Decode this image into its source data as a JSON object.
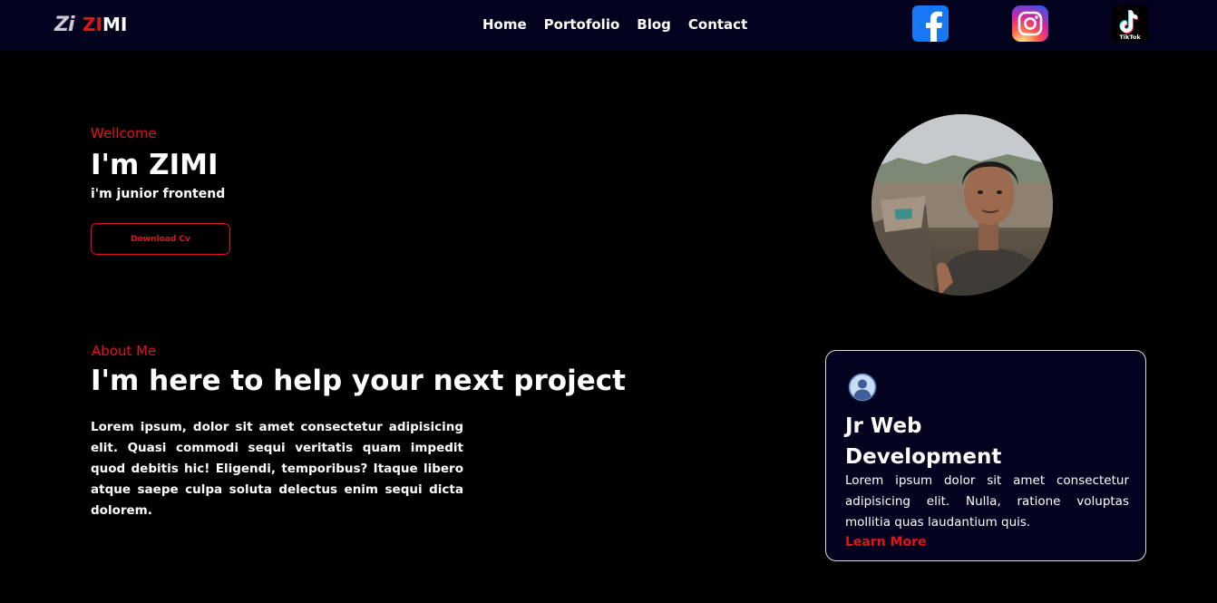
{
  "nav": {
    "logo_mark": "Zi",
    "logo_red": "ZI",
    "logo_white": "MI",
    "menu": [
      {
        "label": "Home"
      },
      {
        "label": "Portofolio"
      },
      {
        "label": "Blog"
      },
      {
        "label": "Contact"
      }
    ],
    "social": {
      "facebook_icon": "facebook-icon",
      "instagram_icon": "instagram-icon",
      "tiktok_icon": "tiktok-icon",
      "tiktok_label": "TikTok"
    }
  },
  "hero": {
    "greeting": "Wellcome",
    "title": "I'm ZIMI",
    "role": "i'm junior frontend",
    "cv_button": "Download Cv",
    "photo_icon": "profile-photo"
  },
  "about": {
    "label": "About Me",
    "title": "I'm here to help your next project",
    "text": "Lorem ipsum, dolor sit amet consectetur adipisicing elit. Quasi commodi sequi veritatis quam impedit quod debitis hic! Eligendi, temporibus? Itaque libero atque saepe culpa soluta delectus enim sequi dicta dolorem."
  },
  "service_card": {
    "icon": "user-circle-icon",
    "title": "Jr Web Development",
    "text": "Lorem ipsum dolor sit amet consectetur adipisicing elit. Nulla, ratione voluptas mollitia quas laudantium quis.",
    "link": "Learn More"
  },
  "colors": {
    "accent": "#e3121b",
    "nav_bg": "#02021e",
    "page_bg": "#000000"
  }
}
